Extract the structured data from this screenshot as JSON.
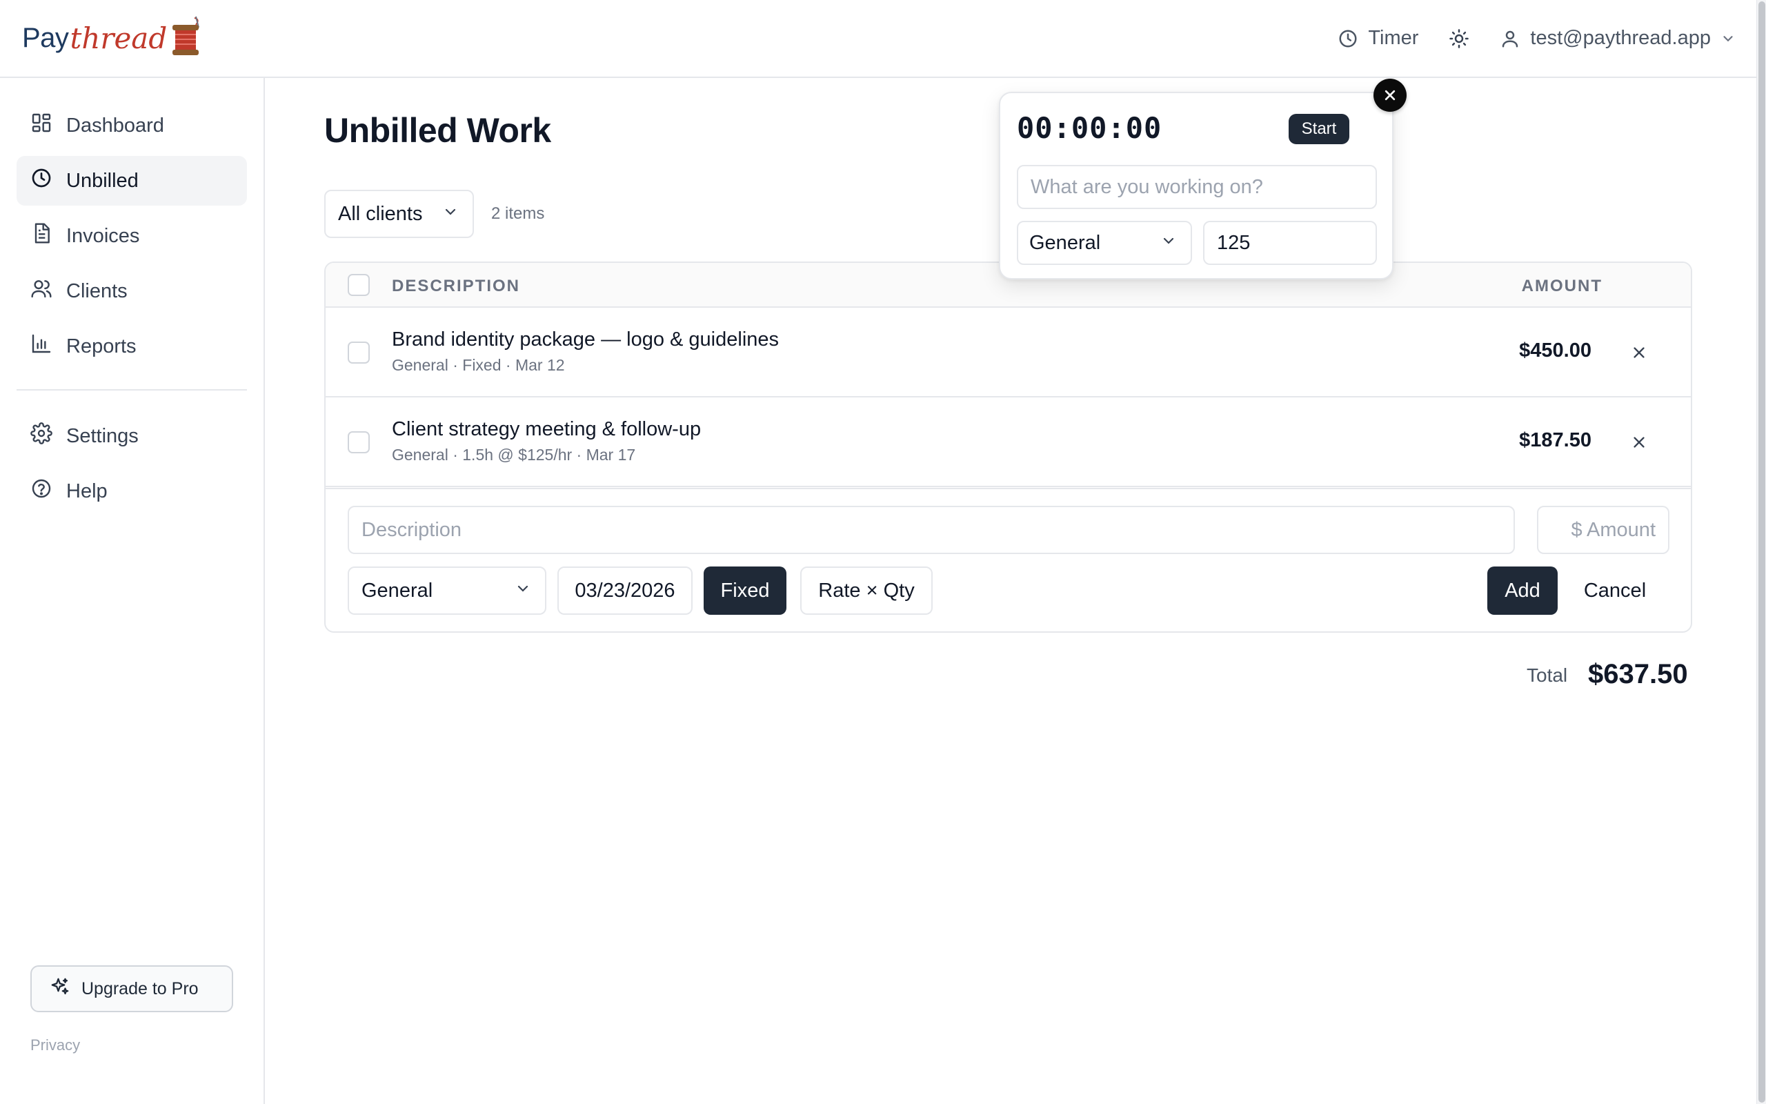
{
  "brand": {
    "part1": "Pay",
    "part2": "thread"
  },
  "header": {
    "timer_label": "Timer",
    "user_email": "test@paythread.app"
  },
  "sidebar": {
    "items": [
      {
        "label": "Dashboard",
        "icon": "dashboard-icon"
      },
      {
        "label": "Unbilled",
        "icon": "clock-icon",
        "active": true
      },
      {
        "label": "Invoices",
        "icon": "document-icon"
      },
      {
        "label": "Clients",
        "icon": "users-icon"
      },
      {
        "label": "Reports",
        "icon": "bar-chart-icon"
      }
    ],
    "secondary": [
      {
        "label": "Settings",
        "icon": "gear-icon"
      },
      {
        "label": "Help",
        "icon": "help-icon"
      }
    ],
    "upgrade_label": "Upgrade to Pro",
    "privacy_label": "Privacy"
  },
  "main": {
    "title": "Unbilled Work",
    "client_filter": "All clients",
    "items_count": "2 items",
    "columns": {
      "description": "DESCRIPTION",
      "amount": "AMOUNT"
    },
    "rows": [
      {
        "title": "Brand identity package — logo & guidelines",
        "meta": "General · Fixed · Mar 12",
        "amount": "$450.00"
      },
      {
        "title": "Client strategy meeting & follow-up",
        "meta": "General · 1.5h @ $125/hr · Mar 17",
        "amount": "$187.50"
      }
    ],
    "form": {
      "description_placeholder": "Description",
      "amount_placeholder": "$ Amount",
      "category": "General",
      "date": "03/23/2026",
      "fixed_label": "Fixed",
      "rate_qty_label": "Rate × Qty",
      "add_label": "Add",
      "cancel_label": "Cancel"
    },
    "total_label": "Total",
    "total_value": "$637.50"
  },
  "timer_popover": {
    "elapsed": "00:00:00",
    "start_label": "Start",
    "task_placeholder": "What are you working on?",
    "category": "General",
    "rate_value": "125"
  },
  "colors": {
    "accent_dark": "#1f2937",
    "brand_red": "#c0392b",
    "brand_navy": "#1e3a5f",
    "active_nav_bg": "#f3f4f6"
  }
}
